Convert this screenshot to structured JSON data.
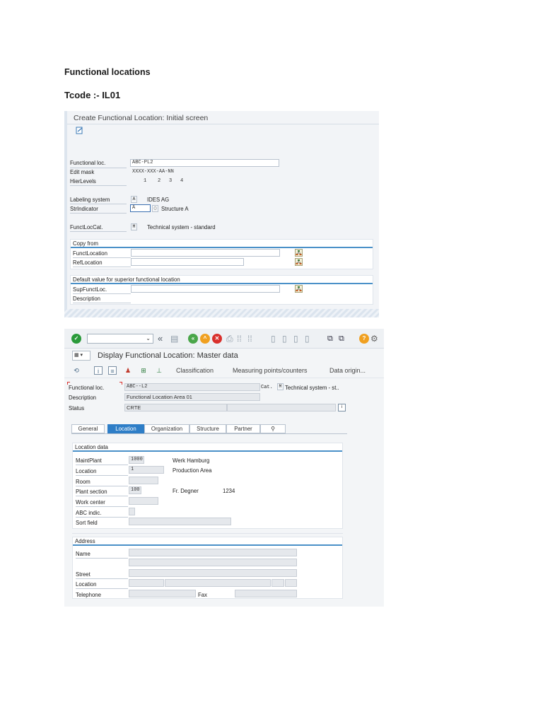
{
  "document": {
    "heading": "Functional locations",
    "tcode": "Tcode :- IL01"
  },
  "screen1": {
    "title": "Create Functional Location: Initial screen",
    "fields": {
      "functional_loc_label": "Functional loc.",
      "functional_loc_value": "ABC-PL2",
      "edit_mask_label": "Edit mask",
      "edit_mask_value": "XXXX-XXX-AA-NN",
      "hier_levels_label": "HierLevels",
      "hier_levels_values": [
        "1",
        "2",
        "3",
        "4"
      ],
      "labeling_system_label": "Labeling system",
      "labeling_system_code": "A",
      "labeling_system_text": "IDES AG",
      "str_indicator_label": "StrIndicator",
      "str_indicator_code": "A",
      "str_indicator_text": "Structure A",
      "funct_loc_cat_label": "FunctLocCat.",
      "funct_loc_cat_code": "M",
      "funct_loc_cat_text": "Technical system - standard"
    },
    "copy_from": {
      "title": "Copy from",
      "funct_location_label": "FunctLocation",
      "ref_location_label": "RefLocation"
    },
    "default_value": {
      "title": "Default value for superior functional location",
      "sup_funct_loc_label": "SupFunctLoc.",
      "description_label": "Description"
    }
  },
  "screen2": {
    "title": "Display Functional Location: Master data",
    "app_toolbar": {
      "classification": "Classification",
      "measuring_points": "Measuring points/counters",
      "data_origin": "Data origin..."
    },
    "header": {
      "functional_loc_label": "Functional loc.",
      "functional_loc_value": "ABC--L2",
      "cat_label": "Cat.",
      "cat_code": "M",
      "cat_text": "Technical system - st..",
      "description_label": "Description",
      "description_value": "Functional Location Area 01",
      "status_label": "Status",
      "status_value": "CRTE"
    },
    "tabs": [
      "General",
      "Location",
      "Organization",
      "Structure",
      "Partner"
    ],
    "active_tab": "Location",
    "location_data": {
      "title": "Location data",
      "maint_plant_label": "MaintPlant",
      "maint_plant_value": "1000",
      "maint_plant_text": "Werk Hamburg",
      "location_label": "Location",
      "location_value": "1",
      "location_text": "Production Area",
      "room_label": "Room",
      "plant_section_label": "Plant section",
      "plant_section_value": "100",
      "plant_section_person": "Fr. Degner",
      "plant_section_phone": "1234",
      "work_center_label": "Work center",
      "abc_indic_label": "ABC indic.",
      "sort_field_label": "Sort field"
    },
    "address": {
      "title": "Address",
      "name_label": "Name",
      "street_label": "Street",
      "location_label": "Location",
      "telephone_label": "Telephone",
      "fax_label": "Fax"
    }
  },
  "colors": {
    "sap_blue": "#2e7ec7",
    "section_line": "#4a90c8",
    "ok_green": "#2a9a3a",
    "nav_green": "#4aa64a",
    "nav_orange": "#f0a020",
    "cancel_red": "#d9302c",
    "help_orange": "#f0a020"
  }
}
